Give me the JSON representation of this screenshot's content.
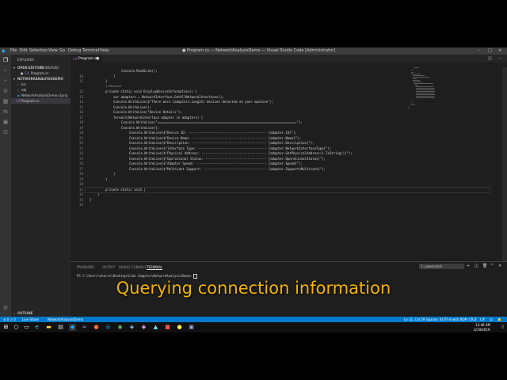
{
  "menu": [
    "File",
    "Edit",
    "Selection",
    "View",
    "Go",
    "Debug",
    "Terminal",
    "Help"
  ],
  "window_title": "● Program.cs — NetworkAnalysisDemo — Visual Studio Code [Administrator]",
  "sidebar": {
    "explorer_label": "EXPLORER",
    "open_editors_label": "OPEN EDITORS",
    "open_editors_badge": "1 UNSAVED",
    "open_file": "Program.cs",
    "project_label": "NETWORKANALYSISDEMO",
    "items": [
      {
        "label": "bin",
        "type": "folder"
      },
      {
        "label": "obj",
        "type": "folder"
      },
      {
        "label": "NetworkAnalysisDemo.csproj",
        "type": "file"
      },
      {
        "label": "Program.cs",
        "type": "file"
      }
    ],
    "outline_label": "OUTLINE"
  },
  "tab": {
    "label": "Program.cs"
  },
  "code_lines": [
    {
      "n": "",
      "t": "Console.ReadLine();",
      "indent": 4
    },
    {
      "n": "10",
      "t": "}",
      "indent": 3
    },
    {
      "n": "11",
      "t": "}",
      "indent": 2
    },
    {
      "n": "",
      "t": "1 reference",
      "lens": true,
      "indent": 2
    },
    {
      "n": "12",
      "t": "private static void DisplayDeviceInformation() {",
      "indent": 2
    },
    {
      "n": "13",
      "t": "var adapters = NetworkInterface.GetAllNetworkInterfaces();",
      "indent": 3
    },
    {
      "n": "14",
      "t": "Console.WriteLine($\"There were {adapters.Length} devices detected on your machine\");",
      "indent": 3
    },
    {
      "n": "15",
      "t": "Console.WriteLine();",
      "indent": 3
    },
    {
      "n": "16",
      "t": "Console.WriteLine(\"Device Details\");",
      "indent": 3
    },
    {
      "n": "17",
      "t": "foreach(NetworkInterface adapter in adapters) {",
      "indent": 3
    },
    {
      "n": "18",
      "t": "Console.WriteLine(\"=========================================================================\");",
      "indent": 4
    },
    {
      "n": "19",
      "t": "Console.WriteLine();",
      "indent": 4
    },
    {
      "n": "20",
      "t": "Console.WriteLine($\"Device ID: ----------------------------------------- {adapter.Id}\");",
      "indent": 5
    },
    {
      "n": "21",
      "t": "Console.WriteLine($\"Device Name: --------------------------------------- {adapter.Name}\");",
      "indent": 5
    },
    {
      "n": "22",
      "t": "Console.WriteLine($\"Description: --------------------------------------- {adapter.Description}\");",
      "indent": 5
    },
    {
      "n": "23",
      "t": "Console.WriteLine($\"Interface Type: ------------------------------------ {adapter.NetworkInterfaceType}\");",
      "indent": 5
    },
    {
      "n": "24",
      "t": "Console.WriteLine($\"Physical Address: ---------------------------------- {adapter.GetPhysicalAddress().ToString()}\");",
      "indent": 5
    },
    {
      "n": "25",
      "t": "Console.WriteLine($\"Operational Status: -------------------------------- {adapter.OperationalStatus}\");",
      "indent": 5
    },
    {
      "n": "26",
      "t": "Console.WriteLine($\"Adapter Speed: ------------------------------------- {adapter.Speed}\");",
      "indent": 5
    },
    {
      "n": "27",
      "t": "Console.WriteLine($\"Multicast Support: --------------------------------- {adapter.SupportsMulticast}\");",
      "indent": 5
    },
    {
      "n": "28",
      "t": "}",
      "indent": 3
    },
    {
      "n": "29",
      "t": "}",
      "indent": 2
    },
    {
      "n": "30",
      "t": "",
      "indent": 2
    },
    {
      "n": "31",
      "t": "private static void |",
      "indent": 2
    },
    {
      "n": "32",
      "t": "}",
      "indent": 1
    },
    {
      "n": "33",
      "t": "}",
      "indent": 0
    },
    {
      "n": "34",
      "t": "",
      "indent": 0
    }
  ],
  "panel": {
    "tabs": [
      "PROBLEMS",
      "OUTPUT",
      "DEBUG CONSOLE",
      "TERMINAL"
    ],
    "active_tab": "TERMINAL",
    "terminal_select": "1: powershell",
    "terminal_line": "PS C:\\Users\\aharro\\Desktop\\Code Samples\\NetworkAnalysisDemo> "
  },
  "status": {
    "errors": "⊗ 0 ⚠ 0",
    "live_share": "Live Share",
    "project": "NetworkAnalysisDemo",
    "position": "Ln 31, Col 29",
    "spaces": "Spaces: 4",
    "encoding": "UTF-8 with BOM",
    "eol": "CRLF",
    "language": "C#"
  },
  "taskbar": {
    "time": "12:46 AM",
    "date": "3/19/2019"
  },
  "caption": "Querying connection information",
  "colors": {
    "accent": "#007acc",
    "caption": "#f2b400",
    "editor_bg": "#1e1e1e"
  }
}
